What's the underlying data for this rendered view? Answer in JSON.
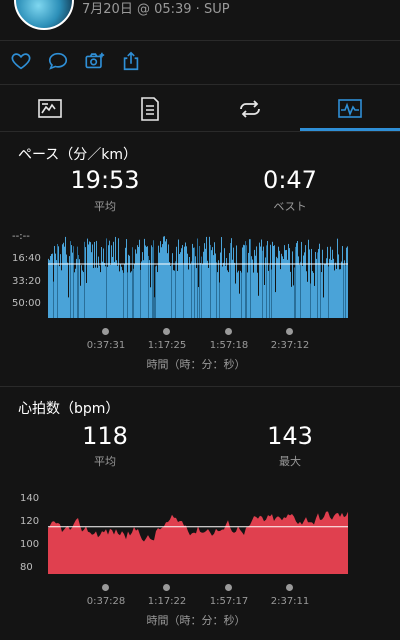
{
  "header": {
    "subtitle": "7月20日 @ 05:39 · SUP"
  },
  "colors": {
    "background": "#141414",
    "accent": "#2f8fd6",
    "pace_fill": "#4aa3d8",
    "hr_fill": "#e0404f",
    "muted_text": "#9a9a9a"
  },
  "actions": [
    {
      "icon": "heart-icon"
    },
    {
      "icon": "comment-icon"
    },
    {
      "icon": "add-photo-icon"
    },
    {
      "icon": "share-icon"
    }
  ],
  "tabs": [
    {
      "icon": "summary-tab-icon",
      "selected": false
    },
    {
      "icon": "details-tab-icon",
      "selected": false
    },
    {
      "icon": "laps-tab-icon",
      "selected": false
    },
    {
      "icon": "charts-tab-icon",
      "selected": true
    }
  ],
  "pace": {
    "title": "ペース（分／km）",
    "avg_value": "19:53",
    "avg_label": "平均",
    "best_value": "0:47",
    "best_label": "ベスト",
    "x_axis_label": "時間（時：分：秒）",
    "chart_data": {
      "type": "area",
      "ylabel_ticks": [
        "--:--",
        "16:40",
        "33:20",
        "50:00"
      ],
      "x_ticks": [
        "0:37:31",
        "1:17:25",
        "1:57:18",
        "2:37:12"
      ],
      "average_line": "19:53",
      "inverted": true
    }
  },
  "hr": {
    "title": "心拍数（bpm）",
    "avg_value": "118",
    "avg_label": "平均",
    "max_value": "143",
    "max_label": "最大",
    "x_axis_label": "時間（時：分：秒）",
    "chart_data": {
      "type": "area",
      "y_ticks": [
        "140",
        "120",
        "100",
        "80"
      ],
      "ylim": [
        72,
        148
      ],
      "x_ticks": [
        "0:37:28",
        "1:17:22",
        "1:57:17",
        "2:37:11"
      ],
      "average_line": 118
    }
  }
}
